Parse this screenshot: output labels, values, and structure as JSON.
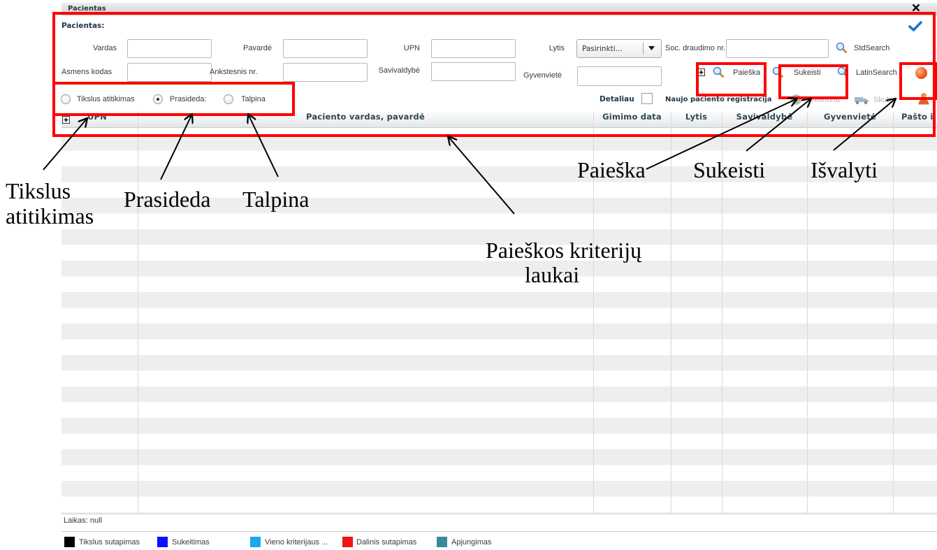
{
  "window": {
    "title": "Pacientas"
  },
  "form": {
    "section_title": "Pacientas:",
    "vardas": {
      "label": "Vardas",
      "value": ""
    },
    "pavarde": {
      "label": "Pavardė",
      "value": ""
    },
    "upn": {
      "label": "UPN",
      "value": ""
    },
    "lytis": {
      "label": "Lytis",
      "selected": "Pasirinkti..."
    },
    "soc_draudimo_nr": {
      "label": "Soc. draudimo nr.",
      "value": ""
    },
    "asmens_kodas": {
      "label": "Asmens kodas",
      "value": ""
    },
    "ankstesnis_nr": {
      "label": "Ankstesnis nr.",
      "value": ""
    },
    "savivaldybe": {
      "label": "Savivaldybė",
      "value": ""
    },
    "gyvenviete": {
      "label": "Gyvenvietė",
      "value": ""
    },
    "match_modes": [
      {
        "label": "Tikslus atitikimas",
        "selected": false
      },
      {
        "label": "Prasideda:",
        "selected": true
      },
      {
        "label": "Talpina",
        "selected": false
      }
    ],
    "details": {
      "label": "Detaliau",
      "checked": false
    }
  },
  "toolbar": {
    "std_search": "StdSearch",
    "search": "Paieška",
    "swap": "Sukeisti",
    "latin_search": "LatinSearch",
    "new_patient": "Naujo paciento registracija",
    "phone": "Telefona",
    "urgent": "Skub"
  },
  "icons": {
    "close": "close-icon",
    "confirm": "checkmark-icon",
    "search": "search-icon",
    "expand": "plus-box-icon",
    "clear": "orange-circle-icon",
    "phone": "phone-icon",
    "ambulance": "ambulance-icon",
    "person": "person-icon"
  },
  "table": {
    "columns": [
      "UPN",
      "Paciento vardas, pavardė",
      "Gimimo data",
      "Lytis",
      "Savivaldybė",
      "Gyvenvietė",
      "Pašto i"
    ],
    "rows": []
  },
  "footer": {
    "time": "Laikas: null",
    "legend": [
      {
        "label": "Tikslus sutapimas",
        "color": "#000000"
      },
      {
        "label": "Sukeitimas",
        "color": "#0d0dff"
      },
      {
        "label": "Vieno kriterijaus ...",
        "color": "#19a7ef"
      },
      {
        "label": "Dalinis sutapimas",
        "color": "#f01414"
      },
      {
        "label": "Apjungimas",
        "color": "#3a8b99"
      }
    ]
  },
  "annotations": {
    "highlight_color": "#ff0000",
    "tikslus_line1": "Tikslus",
    "tikslus_line2": "atitikimas",
    "prasideda": "Prasideda",
    "talpina": "Talpina",
    "paieska": "Paieška",
    "sukeisti": "Sukeisti",
    "isvalyti": "Išvalyti",
    "criteria_line1": "Paieškos kriterijų",
    "criteria_line2": "laukai"
  }
}
